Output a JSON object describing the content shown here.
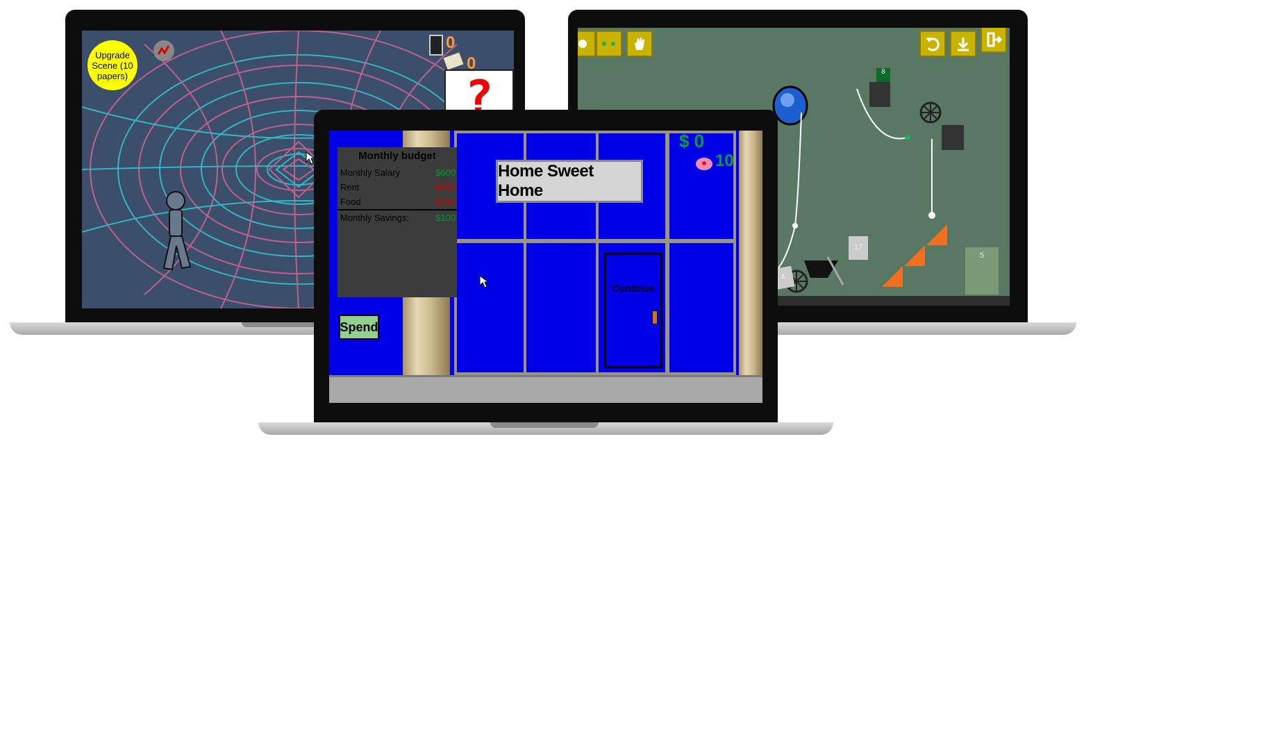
{
  "left_game": {
    "upgrade_button": "Upgrade Scene (10 papers)",
    "score_top": "0",
    "score_bottom": "0",
    "question_mark": "?"
  },
  "right_game": {
    "toolbar_left": [
      "gear-icon",
      "dots-icon",
      "hand-icon"
    ],
    "toolbar_right": [
      "undo-icon",
      "download-icon",
      "exit-icon"
    ],
    "labels": {
      "box_a": "17",
      "box_b": "4",
      "goal": "5",
      "green_box": "8"
    }
  },
  "center_game": {
    "budget": {
      "title": "Monthly budget",
      "rows": [
        {
          "label": "Monthly Salary",
          "value": "$600",
          "kind": "pos"
        },
        {
          "label": "Rent",
          "value": "-$400",
          "kind": "neg"
        },
        {
          "label": "Food",
          "value": "-$100",
          "kind": "neg"
        }
      ],
      "savings_label": "Monthly Savings:",
      "savings_value": "$100"
    },
    "spend_button": "Spend",
    "sign": "Home Sweet Home",
    "continue_label": "Continue",
    "money": "$ 0",
    "piggy_count": "10"
  },
  "colors": {
    "left_bg": "#3b4f6b",
    "right_bg": "#587864",
    "center_window": "#0000e6"
  }
}
